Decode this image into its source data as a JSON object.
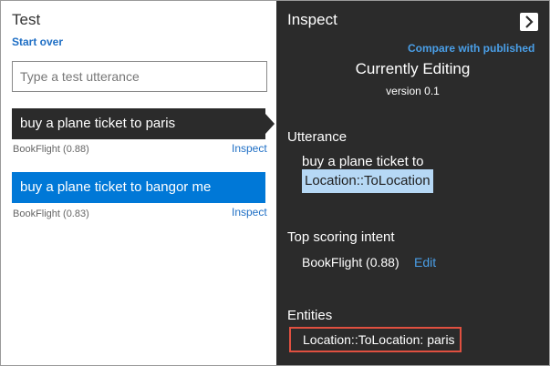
{
  "test_panel": {
    "title": "Test",
    "start_over": "Start over",
    "input_placeholder": "Type a test utterance",
    "utterances": [
      {
        "text": "buy a plane ticket to paris",
        "intent": "BookFlight (0.88)",
        "inspect": "Inspect"
      },
      {
        "text": "buy a plane ticket to bangor me",
        "intent": "BookFlight (0.83)",
        "inspect": "Inspect"
      }
    ]
  },
  "inspect_panel": {
    "title": "Inspect",
    "close_icon": "chevron-right-icon",
    "compare_link": "Compare with published",
    "currently_editing": "Currently Editing",
    "version": "version 0.1",
    "utterance_heading": "Utterance",
    "utterance_text": "buy a plane ticket to",
    "utterance_entity": "Location::ToLocation",
    "top_intent_heading": "Top scoring intent",
    "top_intent_value": "BookFlight (0.88)",
    "edit_link": "Edit",
    "entities_heading": "Entities",
    "entity_value": "Location::ToLocation: paris"
  },
  "colors": {
    "dark_panel": "#2b2b2b",
    "selected_item": "#2b2b2b",
    "highlight_item": "#0078d7",
    "link": "#1f6fc5",
    "link_on_dark": "#4a9fe8",
    "entity_highlight": "#b6d8f5",
    "callout_border": "#e05040"
  }
}
